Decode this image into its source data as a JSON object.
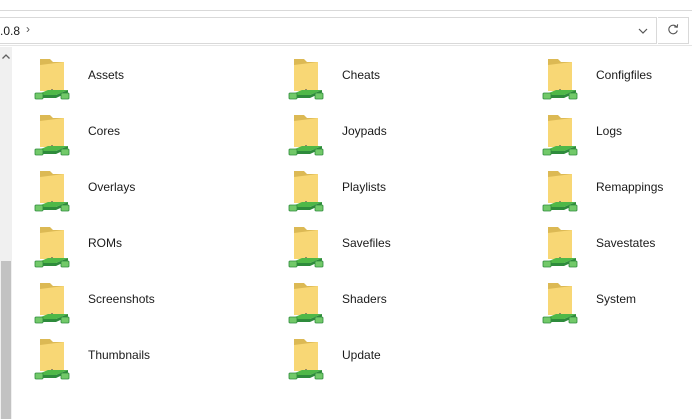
{
  "address_bar": {
    "path_fragment": ".0.8",
    "separator_glyph": "›"
  },
  "folders": [
    {
      "name": "Assets"
    },
    {
      "name": "Cheats"
    },
    {
      "name": "Configfiles"
    },
    {
      "name": "Cores"
    },
    {
      "name": "Joypads"
    },
    {
      "name": "Logs"
    },
    {
      "name": "Overlays"
    },
    {
      "name": "Playlists"
    },
    {
      "name": "Remappings"
    },
    {
      "name": "ROMs"
    },
    {
      "name": "Savefiles"
    },
    {
      "name": "Savestates"
    },
    {
      "name": "Screenshots"
    },
    {
      "name": "Shaders"
    },
    {
      "name": "System"
    },
    {
      "name": "Thumbnails"
    },
    {
      "name": "Update"
    }
  ],
  "icons": {
    "folder": "network-folder-icon",
    "dropdown": "chevron-down-icon",
    "refresh": "refresh-icon",
    "scroll_up": "scroll-up-arrow-icon"
  },
  "colors": {
    "folder_back": "#dcb954",
    "folder_front": "#f8d775",
    "network_green": "#4fb848",
    "border": "#d9d9d9"
  }
}
